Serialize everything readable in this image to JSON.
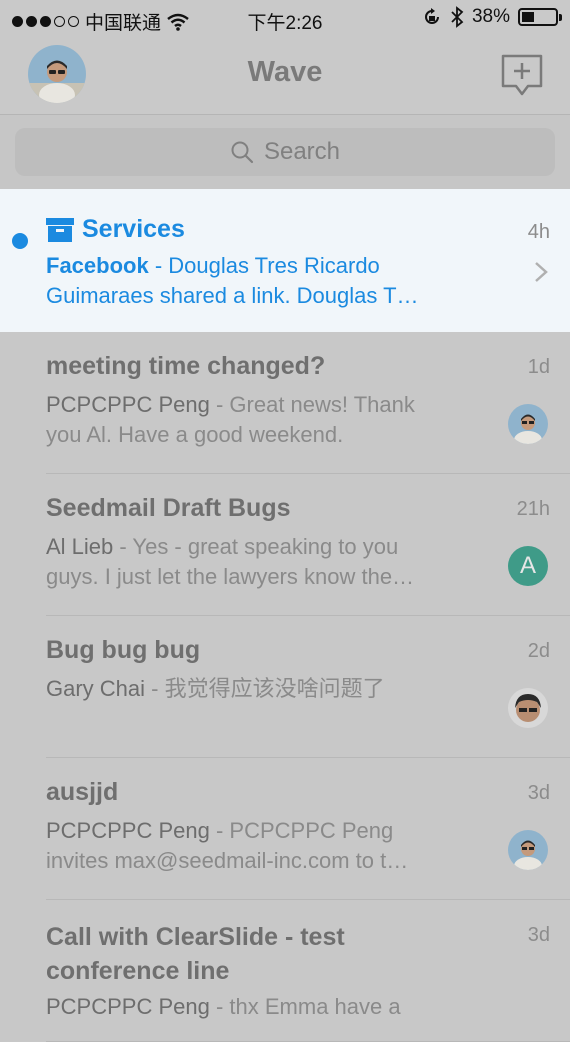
{
  "status_bar": {
    "carrier": "中国联通",
    "time": "下午2:26",
    "battery": "38%"
  },
  "nav": {
    "title": "Wave"
  },
  "search": {
    "placeholder": "Search"
  },
  "threads": [
    {
      "title": "Services",
      "time": "4h",
      "from": "Facebook",
      "line1": " - Douglas Tres Ricardo",
      "line2": "Guimaraes shared a link. Douglas T…",
      "unread": true
    },
    {
      "title": "meeting time changed?",
      "time": "1d",
      "from": "PCPCPPC Peng",
      "line1": " - Great news! Thank",
      "line2": "you Al. Have a good weekend."
    },
    {
      "title": "Seedmail Draft Bugs",
      "time": "21h",
      "from": "Al Lieb",
      "line1": " - Yes - great speaking to you",
      "line2": "guys. I just let the lawyers know the…",
      "avatar_letter": "A"
    },
    {
      "title": "Bug bug bug",
      "time": "2d",
      "from": "Gary Chai",
      "line1": " - 我觉得应该没啥问题了",
      "line2": ""
    },
    {
      "title": "ausjjd",
      "time": "3d",
      "from": "PCPCPPC Peng",
      "line1": " - PCPCPPC Peng",
      "line2": "invites max@seedmail-inc.com to t…"
    },
    {
      "title1": "Call with ClearSlide - test",
      "title2": "conference line",
      "time": "3d",
      "from": "PCPCPPC Peng",
      "line1": " - thx Emma have a"
    }
  ]
}
